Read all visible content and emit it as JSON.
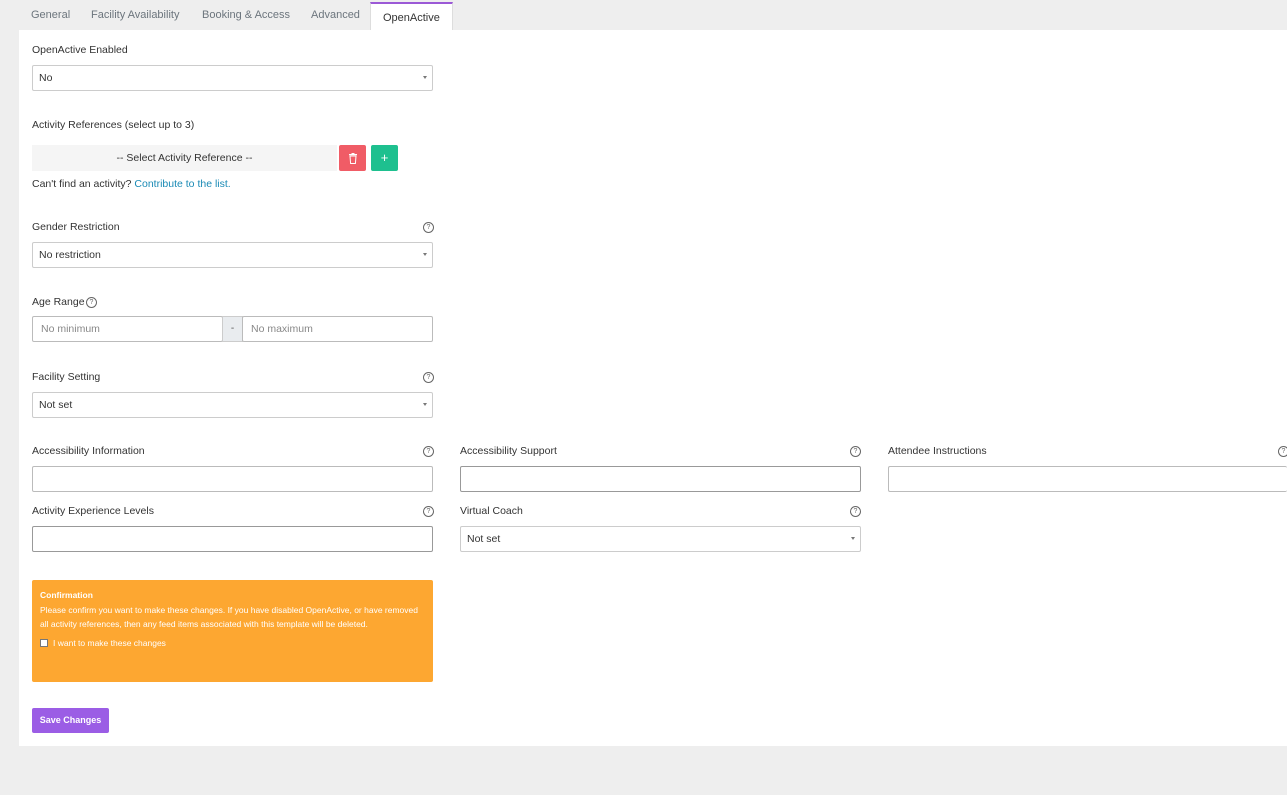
{
  "tabs": [
    "General",
    "Facility Availability",
    "Booking & Access",
    "Advanced",
    "OpenActive"
  ],
  "openactive_enabled": {
    "label": "OpenActive Enabled",
    "value": "No"
  },
  "activity_references": {
    "label": "Activity References (select up to 3)",
    "select_placeholder": "-- Select Activity Reference --",
    "hint_text": "Can't find an activity?",
    "hint_link": "Contribute to the list."
  },
  "gender_restriction": {
    "label": "Gender Restriction",
    "value": "No restriction"
  },
  "age_range": {
    "label": "Age Range",
    "min_placeholder": "No minimum",
    "separator": "-",
    "max_placeholder": "No maximum"
  },
  "facility_setting": {
    "label": "Facility Setting",
    "value": "Not set"
  },
  "accessibility_information": {
    "label": "Accessibility Information",
    "value": ""
  },
  "accessibility_support": {
    "label": "Accessibility Support",
    "value": ""
  },
  "attendee_instructions": {
    "label": "Attendee Instructions",
    "value": ""
  },
  "activity_experience_levels": {
    "label": "Activity Experience Levels",
    "value": ""
  },
  "virtual_coach": {
    "label": "Virtual Coach",
    "value": "Not set"
  },
  "confirmation": {
    "title": "Confirmation",
    "text": "Please confirm you want to make these changes. If you have disabled OpenActive, or have removed all activity references, then any feed items associated with this template will be deleted.",
    "checkbox_label": "I want to make these changes"
  },
  "save_button": "Save Changes",
  "help_glyph": "?",
  "colors": {
    "accent": "#9b5de5",
    "danger": "#f05c66",
    "success": "#1ec08f",
    "warning": "#fda731",
    "link": "#1a8ab5"
  }
}
